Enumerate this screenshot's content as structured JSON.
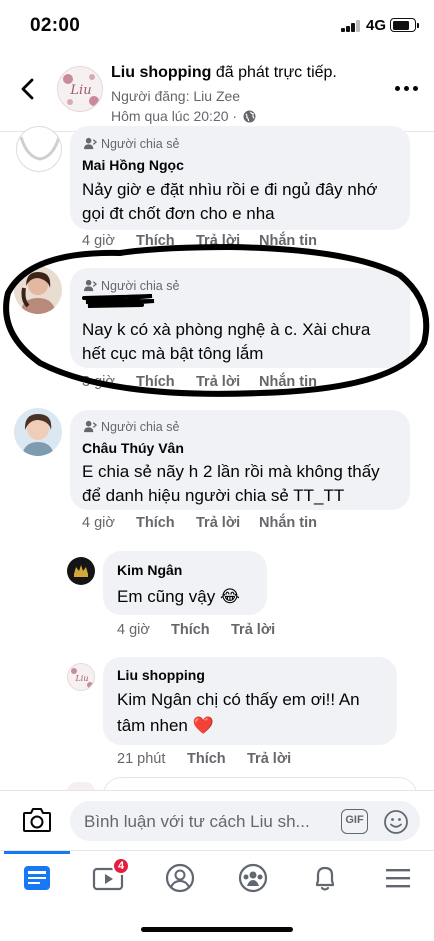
{
  "status": {
    "time": "02:00",
    "network": "4G",
    "battery_level": 0.8
  },
  "post": {
    "page_name": "Liu shopping",
    "action": " đã phát trực tiếp.",
    "poster": "Người đăng: Liu Zee",
    "time": "Hôm qua lúc 20:20 · "
  },
  "comments": [
    {
      "badge": "Người chia sẻ",
      "name": "Mai Hồng Ngọc",
      "lines": [
        "Nảy giờ e đặt nhìu rồi e đi ngủ đây nhớ",
        "gọi đt chốt đơn cho e nha"
      ],
      "time": "4 giờ",
      "like": "Thích",
      "reply": "Trả lời",
      "message": "Nhắn tin"
    },
    {
      "badge": "Người chia sẻ",
      "name": "",
      "lines": [
        "Nay k có xà phòng nghệ à c. Xài chưa",
        "hết cục mà bật tông lắm"
      ],
      "time": "3 giờ",
      "like": "Thích",
      "reply": "Trả lời",
      "message": "Nhắn tin"
    },
    {
      "badge": "Người chia sẻ",
      "name": "Châu Thúy Vân",
      "lines": [
        "E chia sẻ nãy h 2 lần rồi mà không thấy",
        "để danh hiệu người chia sẻ TT_TT"
      ],
      "time": "4 giờ",
      "like": "Thích",
      "reply": "Trả lời",
      "message": "Nhắn tin"
    }
  ],
  "replies": [
    {
      "name": "Kim Ngân",
      "lines": [
        "Em cũng vậy"
      ],
      "emoji": "😂",
      "time": "4 giờ",
      "like": "Thích",
      "reply": "Trả lời"
    },
    {
      "name": "Liu shopping",
      "lines": [
        "Kim Ngân chị có thấy em ơi!! An",
        "tâm nhen"
      ],
      "emoji": "❤️",
      "time": "21 phút",
      "like": "Thích",
      "reply": "Trả lời"
    }
  ],
  "composer": {
    "placeholder": "Bình luận với tư cách Liu sh...",
    "gif_label": "GIF"
  },
  "tabbar": {
    "tabs": [
      "feed",
      "watch",
      "profile",
      "groups",
      "notifications",
      "menu"
    ],
    "active": "feed",
    "watch_badge": "4"
  },
  "colors": {
    "accent": "#1877f2",
    "badge_red": "#e41e3f",
    "bubble": "#f0f2f5",
    "secondary_text": "#65676b"
  },
  "icons": [
    "back-arrow-icon",
    "globe-icon",
    "more-icon",
    "sharer-badge-icon",
    "camera-icon",
    "gif-icon",
    "smiley-icon",
    "feed-icon",
    "watch-icon",
    "profile-icon",
    "groups-icon",
    "bell-icon",
    "menu-icon"
  ]
}
